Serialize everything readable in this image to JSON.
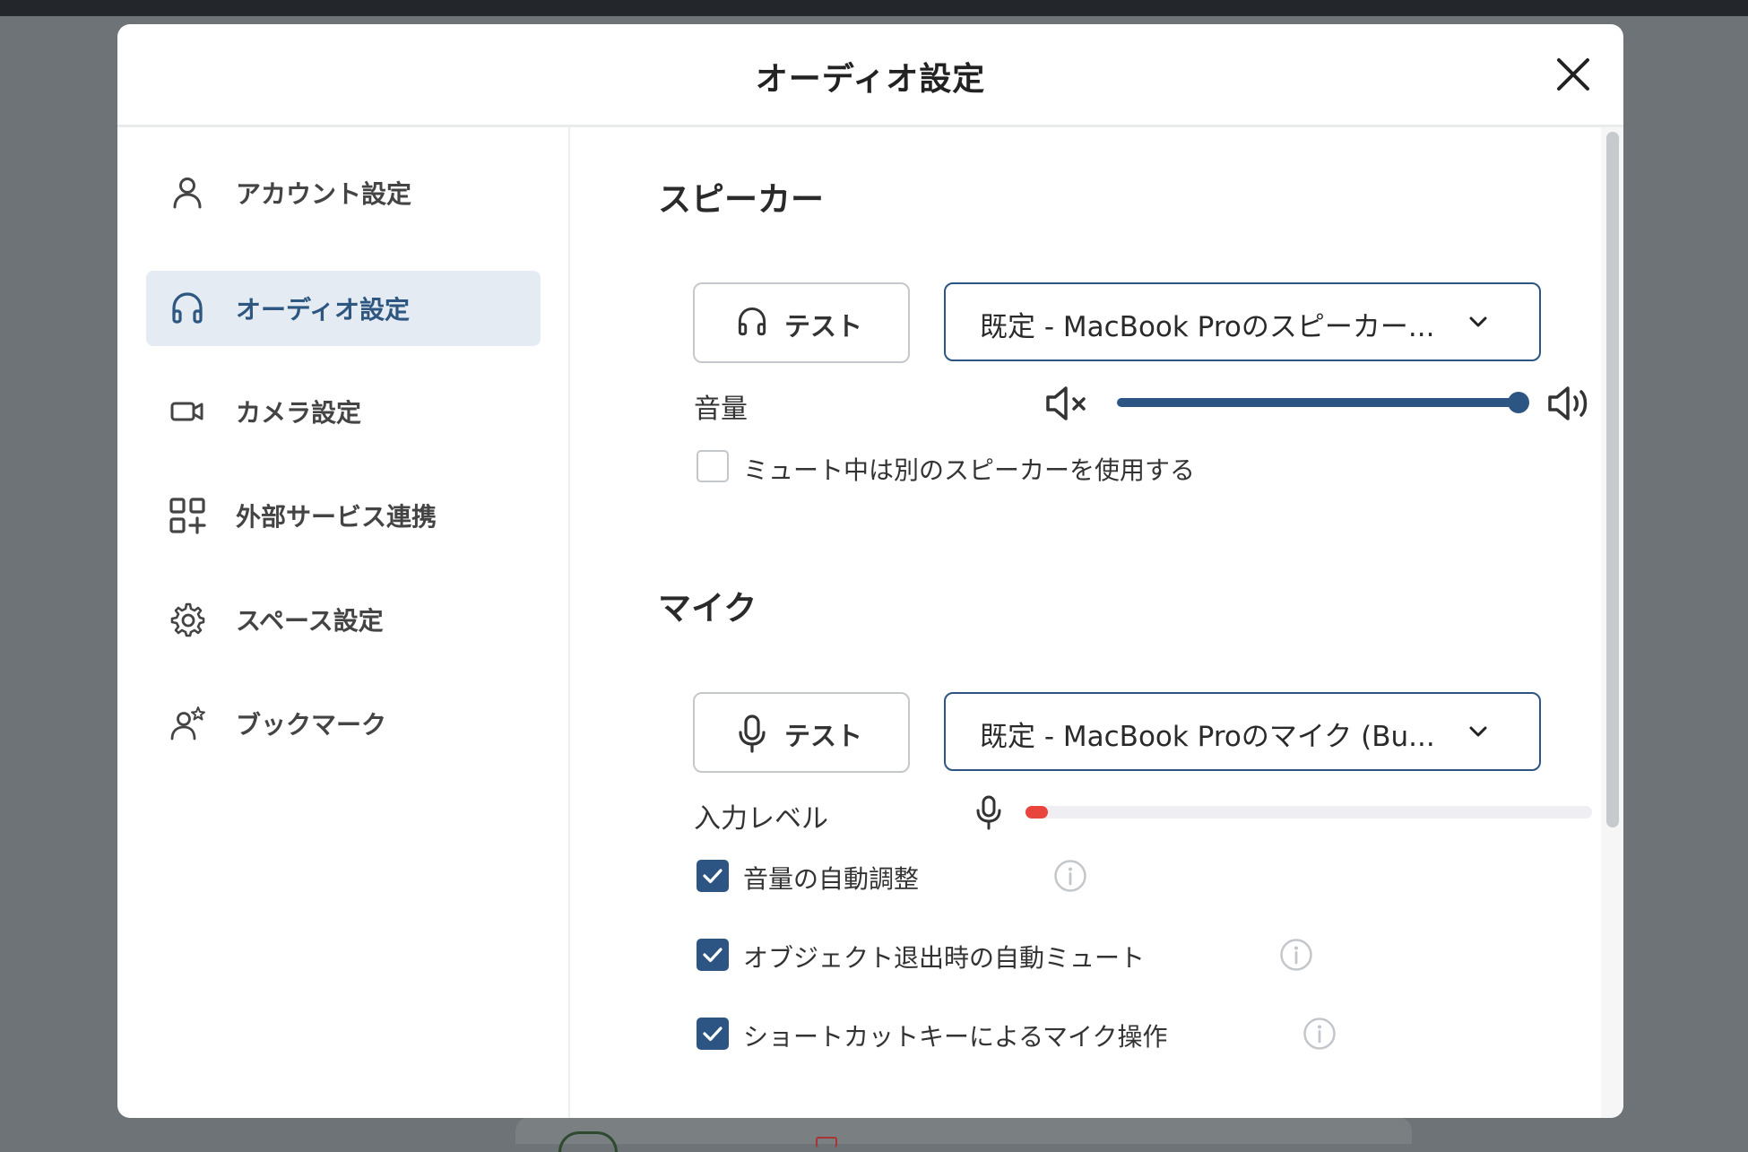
{
  "modal": {
    "title": "オーディオ設定"
  },
  "sidebar": {
    "items": [
      {
        "label": "アカウント設定",
        "icon": "user-icon"
      },
      {
        "label": "オーディオ設定",
        "icon": "headphones-icon",
        "active": true
      },
      {
        "label": "カメラ設定",
        "icon": "video-camera-icon"
      },
      {
        "label": "外部サービス連携",
        "icon": "apps-add-icon"
      },
      {
        "label": "スペース設定",
        "icon": "gear-icon"
      },
      {
        "label": "ブックマーク",
        "icon": "user-star-icon"
      }
    ]
  },
  "speaker": {
    "title": "スピーカー",
    "test_label": "テスト",
    "device": "既定 - MacBook Proのスピーカー...",
    "volume_label": "音量",
    "volume_level": 1.0,
    "mute_option_label": "ミュート中は別のスピーカーを使用する",
    "mute_option_checked": false
  },
  "mic": {
    "title": "マイク",
    "test_label": "テスト",
    "device": "既定 - MacBook Proのマイク (Bu...",
    "input_level_label": "入力レベル",
    "input_level": 0.04,
    "options": [
      {
        "label": "音量の自動調整",
        "checked": true
      },
      {
        "label": "オブジェクト退出時の自動ミュート",
        "checked": true
      },
      {
        "label": "ショートカットキーによるマイク操作",
        "checked": true
      }
    ]
  },
  "colors": {
    "accent": "#2c5583",
    "active_bg": "#e4ebf2",
    "level_red": "#e8453c"
  }
}
